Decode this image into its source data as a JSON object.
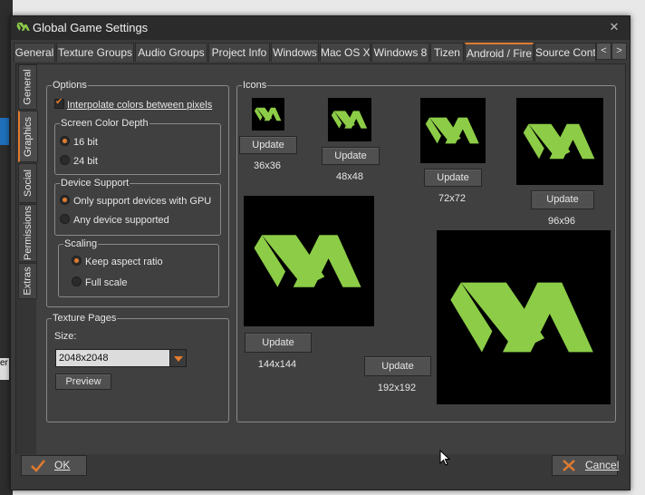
{
  "window": {
    "title": "Global Game Settings",
    "close_glyph": "✕"
  },
  "tabs": [
    "General",
    "Texture Groups",
    "Audio Groups",
    "Project Info",
    "Windows",
    "Mac OS X",
    "Windows 8",
    "Tizen",
    "Android / Fire",
    "Source Cont"
  ],
  "tab_nav": {
    "prev": "<",
    "next": ">"
  },
  "side_tabs": [
    "General",
    "Graphics",
    "Social",
    "Permissions",
    "Extras"
  ],
  "options": {
    "title": "Options",
    "interpolate_label": "Interpolate colors between pixels",
    "interpolate_checked": true,
    "screen_color_depth": {
      "title": "Screen Color Depth",
      "options": [
        "16 bit",
        "24 bit"
      ],
      "selected": "16 bit"
    },
    "device_support": {
      "title": "Device Support",
      "options": [
        "Only support devices with GPU",
        "Any device supported"
      ],
      "selected": "Only support devices with GPU"
    },
    "scaling": {
      "title": "Scaling",
      "options": [
        "Keep aspect ratio",
        "Full scale"
      ],
      "selected": "Keep aspect ratio"
    }
  },
  "texture_pages": {
    "title": "Texture Pages",
    "size_label": "Size:",
    "size_value": "2048x2048",
    "preview_label": "Preview"
  },
  "icons": {
    "title": "Icons",
    "update_label": "Update",
    "sizes": [
      "36x36",
      "48x48",
      "72x72",
      "96x96",
      "144x144",
      "192x192"
    ]
  },
  "footer": {
    "ok_label": "OK",
    "cancel_label": "Cancel"
  },
  "colors": {
    "accent": "#e07b2f",
    "logo_green": "#8ccc47",
    "bg": "#404040"
  },
  "background": {
    "left_strip_text": "er"
  }
}
